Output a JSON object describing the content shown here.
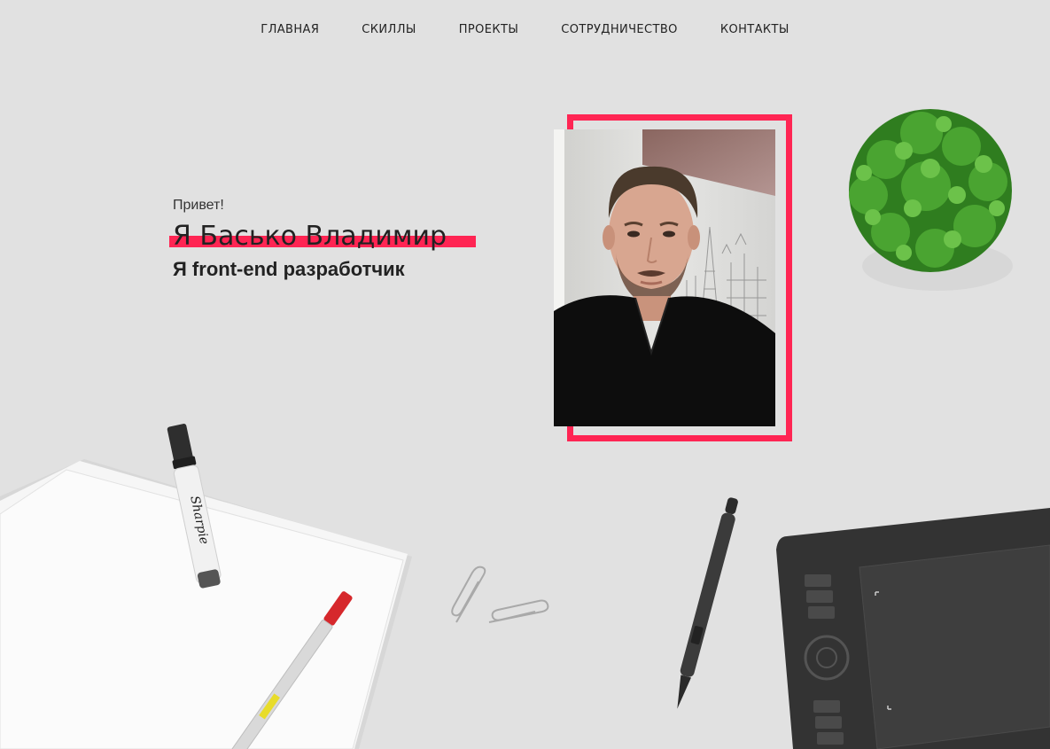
{
  "nav": {
    "items": [
      {
        "label": "ГЛАВНАЯ"
      },
      {
        "label": "СКИЛЛЫ"
      },
      {
        "label": "ПРОЕКТЫ"
      },
      {
        "label": "СОТРУДНИЧЕСТВО"
      },
      {
        "label": "КОНТАКТЫ"
      }
    ]
  },
  "hero": {
    "greeting": "Привет!",
    "name": "Я Басько Владимир",
    "role": "Я front-end разработчик"
  },
  "colors": {
    "accent": "#ff2553",
    "background": "#e1e1e1",
    "text": "#222222"
  },
  "decor": {
    "marker_brand": "Sharpie",
    "icons": [
      "plant-icon",
      "paper-stack-icon",
      "sharpie-marker-icon",
      "red-pen-icon",
      "paperclip-icon",
      "stylus-pen-icon",
      "drawing-tablet-icon"
    ]
  }
}
